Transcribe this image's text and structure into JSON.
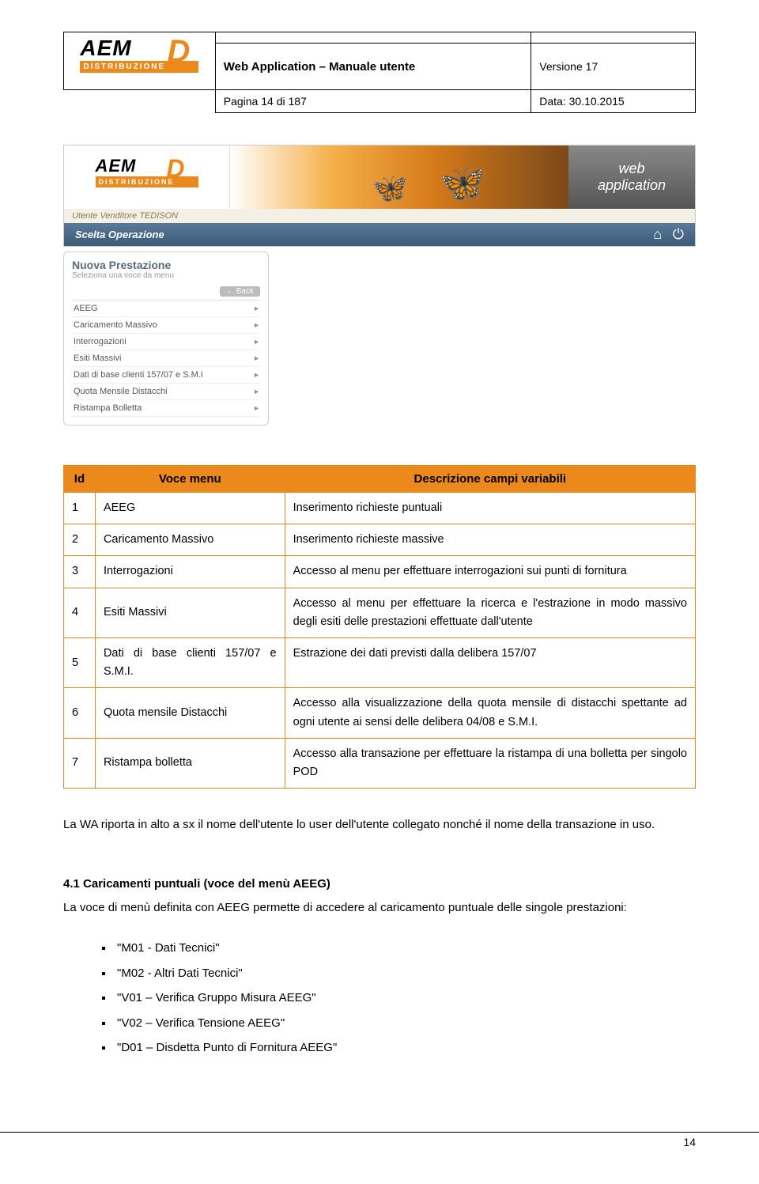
{
  "header": {
    "logo_main": "AEM",
    "logo_letter": "D",
    "logo_sub": "DISTRIBUZIONE",
    "title": "Web Application – Manuale utente",
    "version": "Versione 17",
    "page": "Pagina 14 di 187",
    "date": "Data: 30.10.2015"
  },
  "banner": {
    "app_label_1": "web",
    "app_label_2": "application",
    "user_line": "Utente Venditore TEDISON",
    "breadcrumb": "Scelta Operazione",
    "home_icon": "⌂",
    "off_icon": "⏻"
  },
  "sidebar": {
    "title": "Nuova Prestazione",
    "subtitle": "Seleziona una voce da menu",
    "back": "← Back",
    "items": [
      "AEEG",
      "Caricamento Massivo",
      "Interrogazioni",
      "Esiti Massivi",
      "Dati di base clienti 157/07 e S.M.I",
      "Quota Mensile Distacchi",
      "Ristampa Bolletta"
    ]
  },
  "table": {
    "headers": {
      "id": "Id",
      "voce": "Voce menu",
      "desc": "Descrizione campi variabili"
    },
    "rows": [
      {
        "id": "1",
        "voce": "AEEG",
        "desc": "Inserimento richieste puntuali"
      },
      {
        "id": "2",
        "voce": "Caricamento Massivo",
        "desc": "Inserimento richieste massive"
      },
      {
        "id": "3",
        "voce": "Interrogazioni",
        "desc": "Accesso al menu per effettuare interrogazioni sui punti di fornitura"
      },
      {
        "id": "4",
        "voce": "Esiti Massivi",
        "desc": "Accesso al menu per effettuare la ricerca e l'estrazione in modo massivo degli esiti delle prestazioni effettuate dall'utente"
      },
      {
        "id": "5",
        "voce": "Dati di base clienti 157/07 e S.M.I.",
        "desc": "Estrazione dei dati previsti dalla delibera 157/07"
      },
      {
        "id": "6",
        "voce": "Quota mensile Distacchi",
        "desc": "Accesso alla visualizzazione della quota mensile di distacchi spettante ad ogni utente ai sensi delle delibera 04/08 e S.M.I."
      },
      {
        "id": "7",
        "voce": "Ristampa bolletta",
        "desc": "Accesso alla transazione per effettuare la ristampa di una bolletta per singolo POD"
      }
    ]
  },
  "paragraph1": "La WA riporta in alto a sx il nome dell'utente lo user dell'utente collegato nonché il nome della transazione in uso.",
  "section_title": "4.1 Caricamenti puntuali  (voce del menù AEEG)",
  "paragraph2": "La voce di menù definita con AEEG permette di accedere al caricamento puntuale delle singole prestazioni:",
  "bullets": [
    "\"M01 - Dati Tecnici\"",
    "\"M02 - Altri Dati Tecnici\"",
    "\"V01 – Verifica Gruppo Misura AEEG\"",
    "\"V02 – Verifica Tensione AEEG\"",
    "\"D01 – Disdetta Punto di Fornitura AEEG\""
  ],
  "footer_page": "14"
}
